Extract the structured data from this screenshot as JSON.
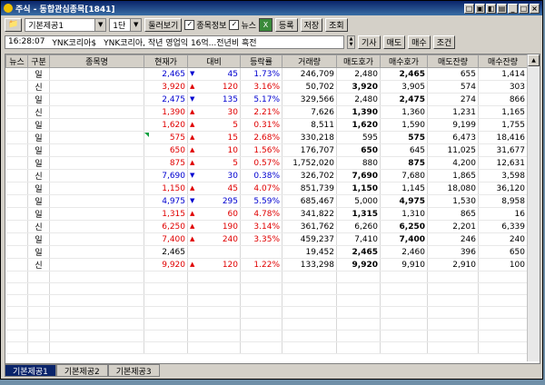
{
  "window": {
    "title": "주식 - 동합관심종목[1841]",
    "buttons": [
      "□",
      "▣",
      "◧",
      "▤",
      "_",
      "□",
      "×"
    ]
  },
  "toolbar": {
    "group_value": "기본제공1",
    "unit_value": "1단",
    "browse_label": "둘러보기",
    "stockinfo_label": "종목정보",
    "news_label": "뉴스",
    "register_label": "등록",
    "save_label": "저장",
    "query_label": "조회"
  },
  "news": {
    "time": "16:28:07",
    "stock": "YNK코리아$",
    "headline": "YNK코리아, 작년 영업익 16억...전년비 흑전",
    "buttons": [
      "기사",
      "매도",
      "매수",
      "조건"
    ]
  },
  "columns": [
    "뉴스",
    "구분",
    "종목명",
    "현재가",
    "대비",
    "등락률",
    "거래량",
    "매도호가",
    "매수호가",
    "매도잔량",
    "매수잔량"
  ],
  "rows": [
    {
      "g": "일",
      "price": "2,465",
      "dir": "down",
      "diff": "45",
      "rate": "1.73%",
      "vol": "246,709",
      "ask": "2,480",
      "bid": "2,465",
      "askq": "655",
      "bidq": "1,414",
      "pc": "blue",
      "bidbold": true,
      "askbold": false
    },
    {
      "g": "신",
      "price": "3,920",
      "dir": "up",
      "diff": "120",
      "rate": "3.16%",
      "vol": "50,702",
      "ask": "3,920",
      "bid": "3,905",
      "askq": "574",
      "bidq": "303",
      "pc": "red",
      "bidbold": false,
      "askbold": true
    },
    {
      "g": "일",
      "price": "2,475",
      "dir": "down",
      "diff": "135",
      "rate": "5.17%",
      "vol": "329,566",
      "ask": "2,480",
      "bid": "2,475",
      "askq": "274",
      "bidq": "866",
      "pc": "blue",
      "bidbold": true,
      "askbold": false
    },
    {
      "g": "신",
      "price": "1,390",
      "dir": "up",
      "diff": "30",
      "rate": "2.21%",
      "vol": "7,626",
      "ask": "1,390",
      "bid": "1,360",
      "askq": "1,231",
      "bidq": "1,165",
      "pc": "red",
      "bidbold": false,
      "askbold": true
    },
    {
      "g": "일",
      "price": "1,620",
      "dir": "up",
      "diff": "5",
      "rate": "0.31%",
      "vol": "8,511",
      "ask": "1,620",
      "bid": "1,590",
      "askq": "9,199",
      "bidq": "1,755",
      "pc": "red",
      "bidbold": false,
      "askbold": true
    },
    {
      "g": "일",
      "price": "575",
      "dir": "up",
      "diff": "15",
      "rate": "2.68%",
      "vol": "330,218",
      "ask": "595",
      "bid": "575",
      "askq": "6,473",
      "bidq": "18,416",
      "pc": "red",
      "bidbold": true,
      "askbold": false
    },
    {
      "g": "일",
      "price": "650",
      "dir": "up",
      "diff": "10",
      "rate": "1.56%",
      "vol": "176,707",
      "ask": "650",
      "bid": "645",
      "askq": "11,025",
      "bidq": "31,677",
      "pc": "red",
      "bidbold": false,
      "askbold": true
    },
    {
      "g": "일",
      "price": "875",
      "dir": "up",
      "diff": "5",
      "rate": "0.57%",
      "vol": "1,752,020",
      "ask": "880",
      "bid": "875",
      "askq": "4,200",
      "bidq": "12,631",
      "pc": "red",
      "bidbold": true,
      "askbold": false
    },
    {
      "g": "신",
      "price": "7,690",
      "dir": "down",
      "diff": "30",
      "rate": "0.38%",
      "vol": "326,702",
      "ask": "7,690",
      "bid": "7,680",
      "askq": "1,865",
      "bidq": "3,598",
      "pc": "blue",
      "bidbold": false,
      "askbold": true
    },
    {
      "g": "일",
      "price": "1,150",
      "dir": "up",
      "diff": "45",
      "rate": "4.07%",
      "vol": "851,739",
      "ask": "1,150",
      "bid": "1,145",
      "askq": "18,080",
      "bidq": "36,120",
      "pc": "red",
      "bidbold": false,
      "askbold": true
    },
    {
      "g": "일",
      "price": "4,975",
      "dir": "down",
      "diff": "295",
      "rate": "5.59%",
      "vol": "685,467",
      "ask": "5,000",
      "bid": "4,975",
      "askq": "1,530",
      "bidq": "8,958",
      "pc": "blue",
      "bidbold": true,
      "askbold": false
    },
    {
      "g": "일",
      "price": "1,315",
      "dir": "up",
      "diff": "60",
      "rate": "4.78%",
      "vol": "341,822",
      "ask": "1,315",
      "bid": "1,310",
      "askq": "865",
      "bidq": "16",
      "pc": "red",
      "bidbold": false,
      "askbold": true
    },
    {
      "g": "신",
      "price": "6,250",
      "dir": "up",
      "diff": "190",
      "rate": "3.14%",
      "vol": "361,762",
      "ask": "6,260",
      "bid": "6,250",
      "askq": "2,201",
      "bidq": "6,339",
      "pc": "red",
      "bidbold": true,
      "askbold": false
    },
    {
      "g": "일",
      "price": "7,400",
      "dir": "up",
      "diff": "240",
      "rate": "3.35%",
      "vol": "459,237",
      "ask": "7,410",
      "bid": "7,400",
      "askq": "246",
      "bidq": "240",
      "pc": "red",
      "bidbold": true,
      "askbold": false
    },
    {
      "g": "일",
      "price": "2,465",
      "dir": "none",
      "diff": "",
      "rate": "",
      "vol": "19,452",
      "ask": "2,465",
      "bid": "2,460",
      "askq": "396",
      "bidq": "650",
      "pc": "black",
      "bidbold": false,
      "askbold": true
    },
    {
      "g": "신",
      "price": "9,920",
      "dir": "up",
      "diff": "120",
      "rate": "1.22%",
      "vol": "133,298",
      "ask": "9,920",
      "bid": "9,910",
      "askq": "2,910",
      "bidq": "100",
      "pc": "red",
      "bidbold": false,
      "askbold": true
    }
  ],
  "tabs": [
    "기본제공1",
    "기본제공2",
    "기본제공3"
  ],
  "colors": {
    "up": "#e00000",
    "down": "#0000d0",
    "title": "#0a246a"
  }
}
